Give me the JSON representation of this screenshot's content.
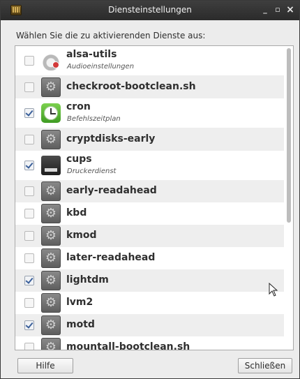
{
  "window": {
    "title": "Diensteinstellungen",
    "minimize": "_",
    "maximize": "▫",
    "close": "×"
  },
  "prompt": "Wählen Sie die zu aktivierenden Dienste aus:",
  "services": [
    {
      "name": "alsa-utils",
      "description": "Audioeinstellungen",
      "checked": false,
      "icon": "audio-icon"
    },
    {
      "name": "checkroot-bootclean.sh",
      "description": "",
      "checked": false,
      "icon": "gear-icon"
    },
    {
      "name": "cron",
      "description": "Befehlszeitplan",
      "checked": true,
      "icon": "clock-icon"
    },
    {
      "name": "cryptdisks-early",
      "description": "",
      "checked": false,
      "icon": "gear-icon"
    },
    {
      "name": "cups",
      "description": "Druckerdienst",
      "checked": true,
      "icon": "printer-icon"
    },
    {
      "name": "early-readahead",
      "description": "",
      "checked": false,
      "icon": "gear-icon"
    },
    {
      "name": "kbd",
      "description": "",
      "checked": false,
      "icon": "gear-icon"
    },
    {
      "name": "kmod",
      "description": "",
      "checked": false,
      "icon": "gear-icon"
    },
    {
      "name": "later-readahead",
      "description": "",
      "checked": false,
      "icon": "gear-icon"
    },
    {
      "name": "lightdm",
      "description": "",
      "checked": true,
      "icon": "gear-icon"
    },
    {
      "name": "lvm2",
      "description": "",
      "checked": false,
      "icon": "gear-icon"
    },
    {
      "name": "motd",
      "description": "",
      "checked": true,
      "icon": "gear-icon"
    },
    {
      "name": "mountall-bootclean.sh",
      "description": "",
      "checked": false,
      "icon": "gear-icon"
    }
  ],
  "buttons": {
    "help": "Hilfe",
    "close": "Schließen"
  }
}
